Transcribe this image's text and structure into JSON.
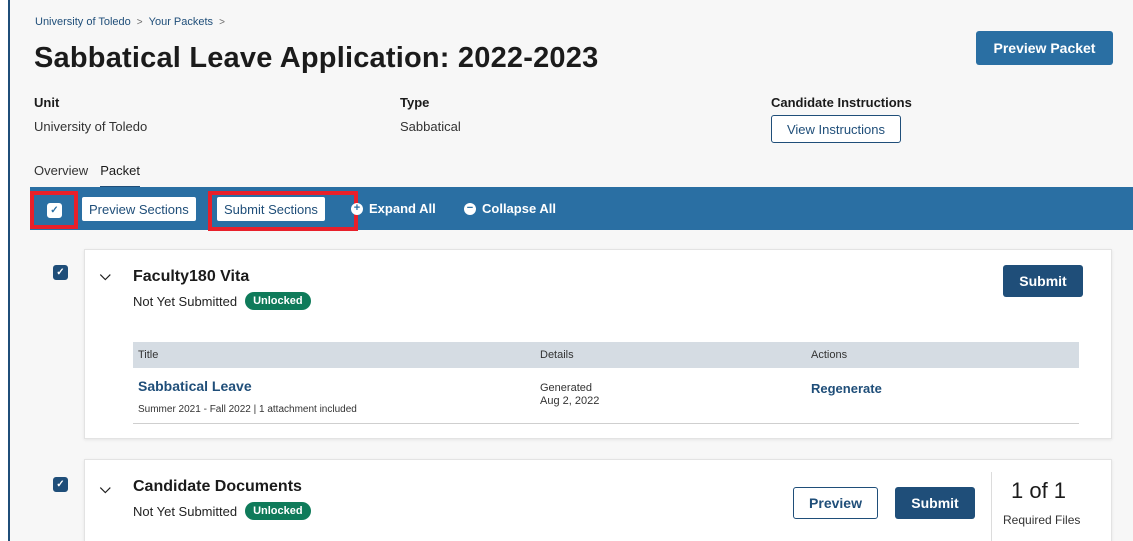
{
  "breadcrumb": {
    "items": [
      "University of Toledo",
      "Your Packets"
    ],
    "separator": ">"
  },
  "page_title": "Sabbatical Leave Application: 2022-2023",
  "header": {
    "preview_packet_label": "Preview Packet",
    "unit_label": "Unit",
    "unit_value": "University of Toledo",
    "type_label": "Type",
    "type_value": "Sabbatical",
    "instructions_label": "Candidate Instructions",
    "view_instructions_label": "View Instructions"
  },
  "tabs": [
    {
      "label": "Overview",
      "active": false
    },
    {
      "label": "Packet",
      "active": true
    }
  ],
  "toolbar": {
    "select_all_checked": true,
    "preview_sections_label": "Preview Sections",
    "submit_sections_label": "Submit Sections",
    "expand_all_label": "Expand All",
    "collapse_all_label": "Collapse All",
    "expand_icon": "plus-circle-icon",
    "collapse_icon": "minus-circle-icon"
  },
  "sections": [
    {
      "title": "Faculty180 Vita",
      "status": "Not Yet Submitted",
      "badge": "Unlocked",
      "checked": true,
      "submit_label": "Submit",
      "table": {
        "headers": [
          "Title",
          "Details",
          "Actions"
        ],
        "rows": [
          {
            "title": "Sabbatical Leave",
            "subtitle": "Summer 2021 - Fall 2022 | 1 attachment included",
            "details_line1": "Generated",
            "details_line2": "Aug 2, 2022",
            "action": "Regenerate"
          }
        ]
      }
    },
    {
      "title": "Candidate Documents",
      "status": "Not Yet Submitted",
      "badge": "Unlocked",
      "checked": true,
      "preview_label": "Preview",
      "submit_label": "Submit",
      "required_count": "1 of 1",
      "required_label": "Required Files"
    }
  ],
  "colors": {
    "toolbar_bg": "#2a6fa3",
    "primary_dark": "#1f4e79",
    "badge_green": "#0f7b5a",
    "highlight_red": "#e8202a"
  }
}
